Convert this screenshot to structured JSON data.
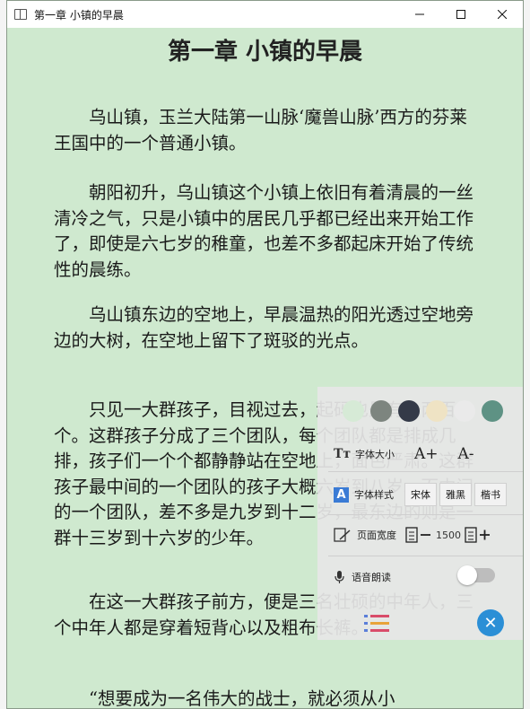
{
  "window": {
    "title": "第一章 小镇的早晨"
  },
  "chapter": {
    "heading": "第一章 小镇的早晨",
    "paragraphs": [
      "乌山镇，玉兰大陆第一山脉‘魔兽山脉’西方的芬莱王国中的一个普通小镇。",
      "朝阳初升，乌山镇这个小镇上依旧有着清晨的一丝清冷之气，只是小镇中的居民几乎都已经出来开始工作了，即使是六七岁的稚童，也差不多都起床开始了传统性的晨练。",
      "乌山镇东边的空地上，早晨温热的阳光透过空地旁边的大树，在空地上留下了斑驳的光点。",
      "只见一大群孩子，目视过去，起码也是有一两百个。这群孩子分成了三个团队，每个团队都是排成几排，孩子们一个个都静静站在空地上，面色严肃。这群孩子最中间的一个团队的孩子大概六岁到八岁。而中间的一个团队，差不多是九岁到十二岁，最东边的则是一群十三岁到十六岁的少年。",
      "在这一大群孩子前方，便是三名壮硕的中年人，三个中年人都是穿着短背心以及粗布长裤。",
      "“想要成为一名伟大的战士，就必须从小"
    ]
  },
  "settings": {
    "theme_colors": [
      "#d6ead6",
      "#7d857f",
      "#343a48",
      "#efe3c4",
      "#eaeaea",
      "#5e9284"
    ],
    "font_size": {
      "label": "字体大小",
      "increase": "A+",
      "decrease": "A-"
    },
    "font_style": {
      "label": "字体样式",
      "options": [
        "宋体",
        "雅黑",
        "楷书"
      ]
    },
    "page_width": {
      "label": "页面宽度",
      "value": "1500"
    },
    "voice": {
      "label": "语音朗读",
      "enabled": false
    },
    "close_icon": "close-icon",
    "accent": "#2b8fd6"
  }
}
